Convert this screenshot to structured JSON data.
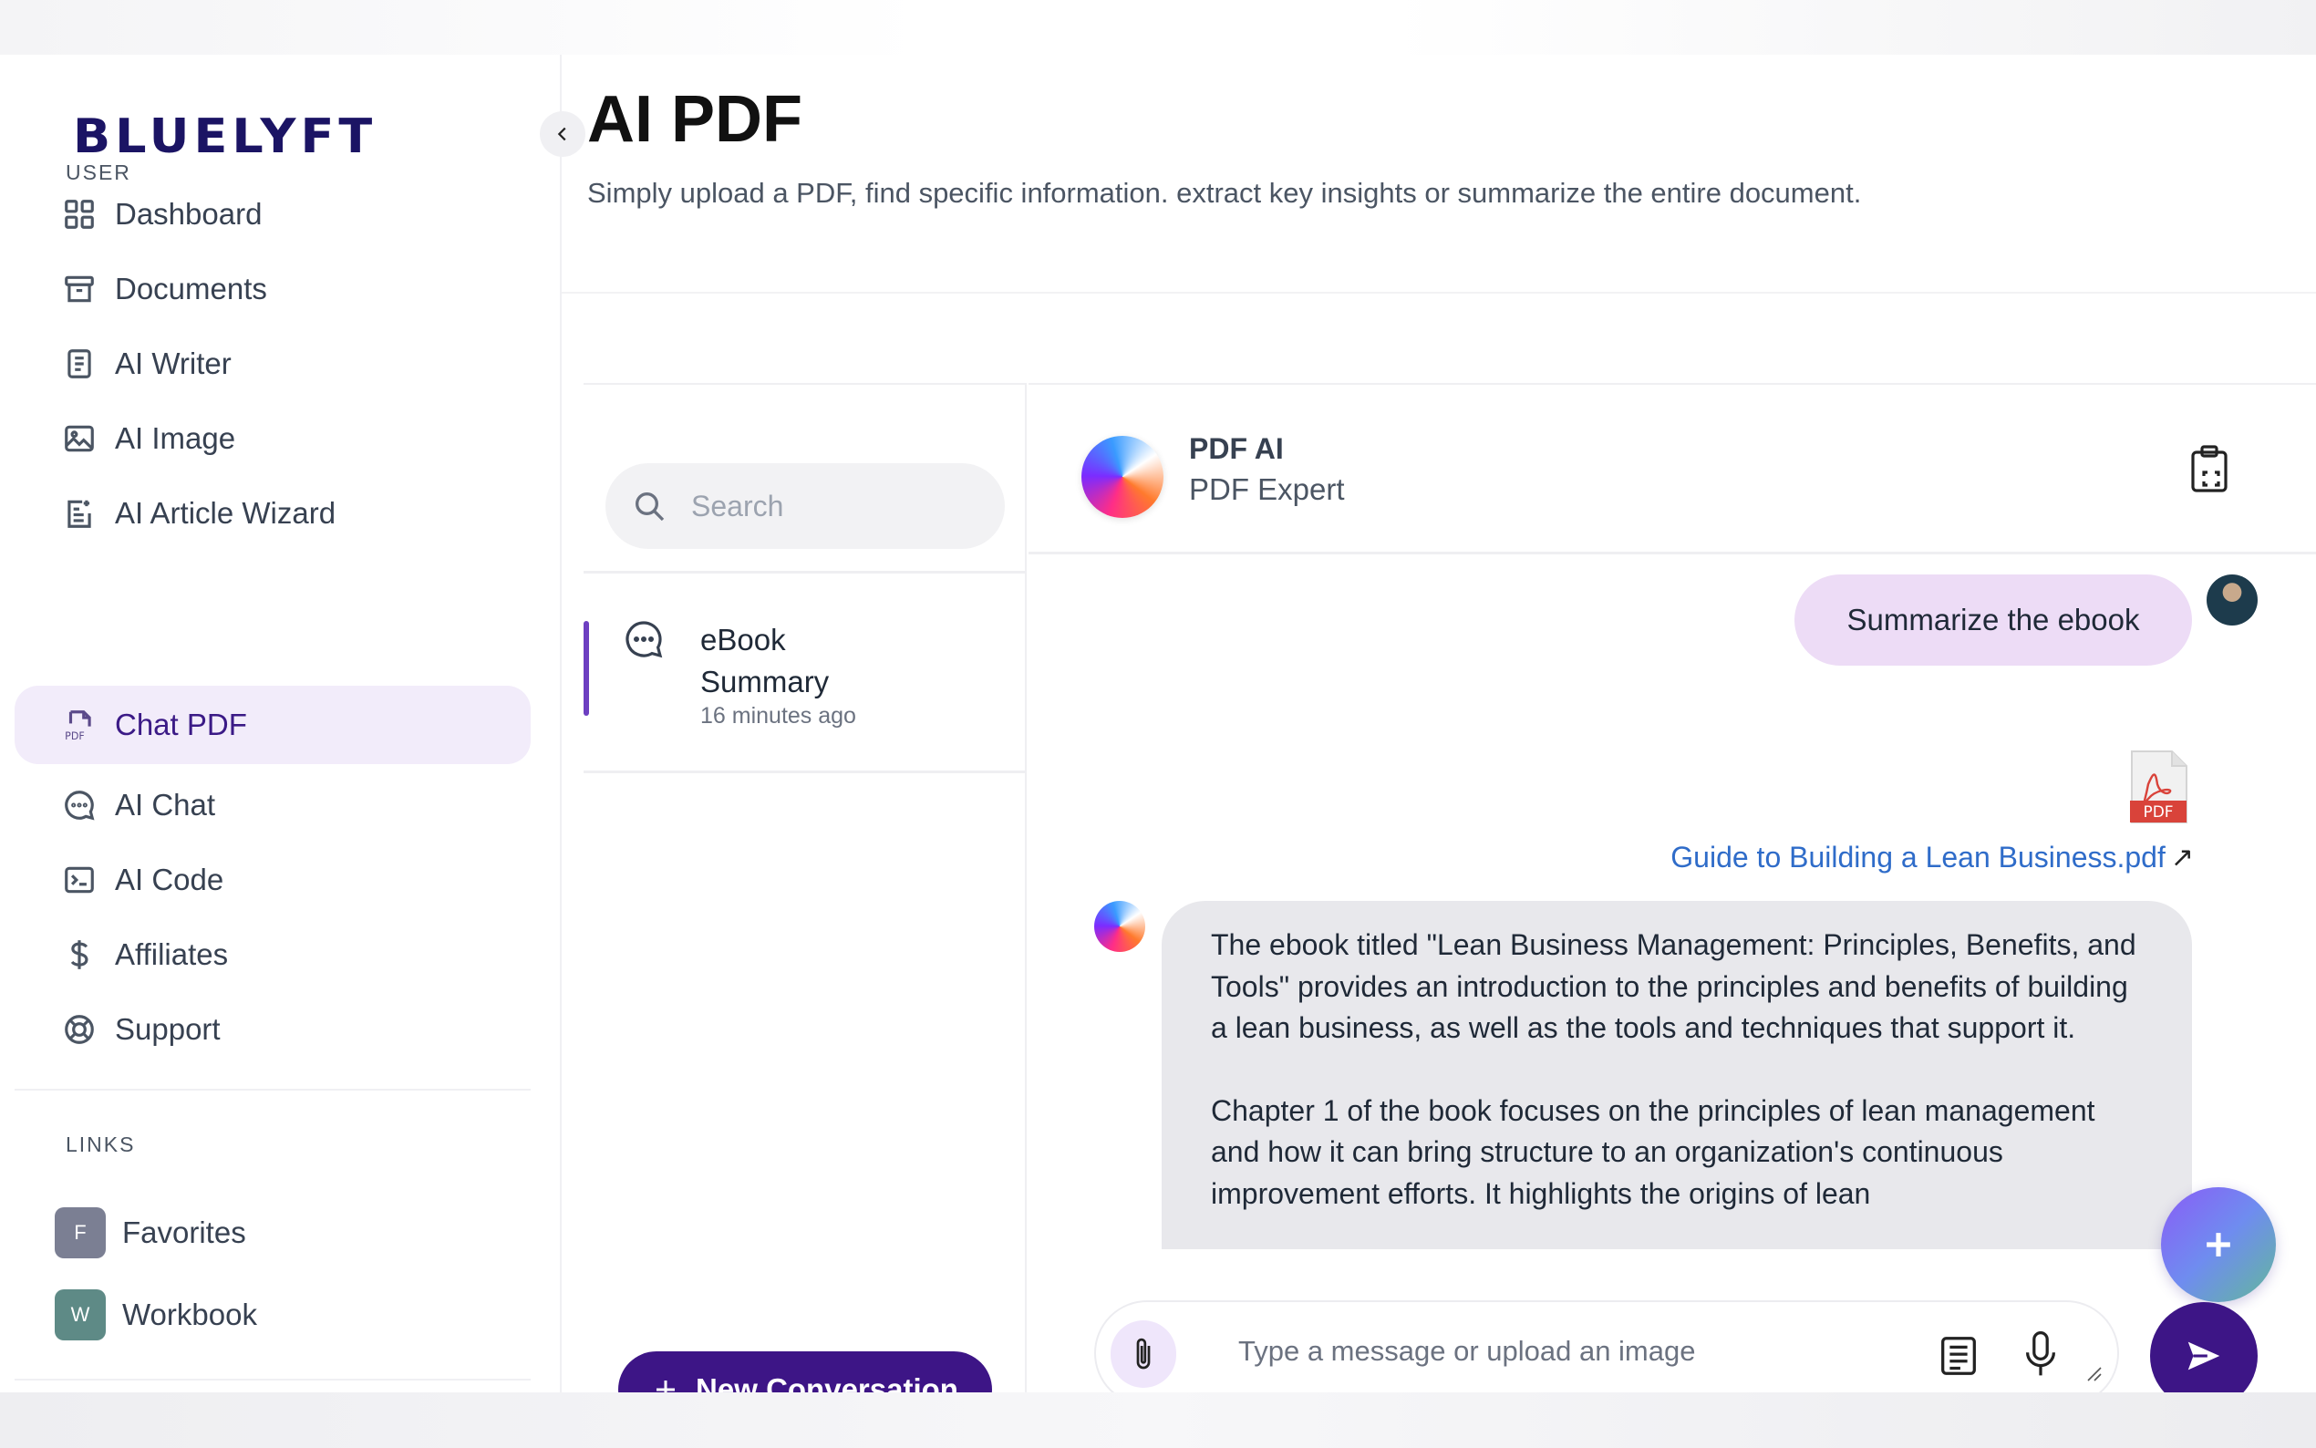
{
  "brand": {
    "logo_text": "BLUELYFT",
    "logo_color": "#1b1464"
  },
  "sidebar": {
    "user_section_label": "USER",
    "items": [
      {
        "label": "Dashboard",
        "icon": "grid-icon"
      },
      {
        "label": "Documents",
        "icon": "archive-box-icon"
      },
      {
        "label": "AI Writer",
        "icon": "document-text-icon"
      },
      {
        "label": "AI Image",
        "icon": "image-icon"
      },
      {
        "label": "AI Article Wizard",
        "icon": "article-wizard-icon"
      },
      {
        "label": "Chat PDF",
        "icon": "pdf-file-icon",
        "active": true
      },
      {
        "label": "AI Chat",
        "icon": "chat-bubble-icon"
      },
      {
        "label": "AI Code",
        "icon": "terminal-icon"
      },
      {
        "label": "Affiliates",
        "icon": "dollar-icon"
      },
      {
        "label": "Support",
        "icon": "lifebuoy-icon"
      }
    ],
    "links_section_label": "LINKS",
    "links": [
      {
        "badge": "F",
        "label": "Favorites",
        "color": "#7b7f93"
      },
      {
        "badge": "W",
        "label": "Workbook",
        "color": "#5e8a86"
      }
    ]
  },
  "header": {
    "title": "AI PDF",
    "description": "Simply upload a PDF, find specific information. extract key insights or summarize the entire document."
  },
  "conversations": {
    "search_placeholder": "Search",
    "items": [
      {
        "title": "eBook Summary",
        "time": "16 minutes ago"
      }
    ],
    "new_button_label": "New Conversation"
  },
  "chat": {
    "assistant_name": "PDF AI",
    "assistant_role": "PDF Expert",
    "messages": {
      "user_text": "Summarize the ebook",
      "attachment_badge": "PDF",
      "attachment_name": "Guide to Building a Lean Business.pdf",
      "attachment_link_arrow": "↗",
      "ai_paragraph_1": "The ebook titled \"Lean Business Management: Principles, Benefits, and Tools\" provides an introduction to the principles and benefits of building a lean business, as well as the tools and techniques that support it.",
      "ai_paragraph_2": "Chapter 1 of the book focuses on the principles of lean management and how it can bring structure to an organization's continuous improvement efforts. It highlights the origins of lean"
    },
    "composer_placeholder": "Type a message or upload an image"
  },
  "colors": {
    "primary": "#3d1586",
    "active_nav_bg": "#f2ecfa",
    "user_bubble": "#eddcf6",
    "ai_bubble": "#e8e8ec",
    "link": "#2f6cc9"
  }
}
